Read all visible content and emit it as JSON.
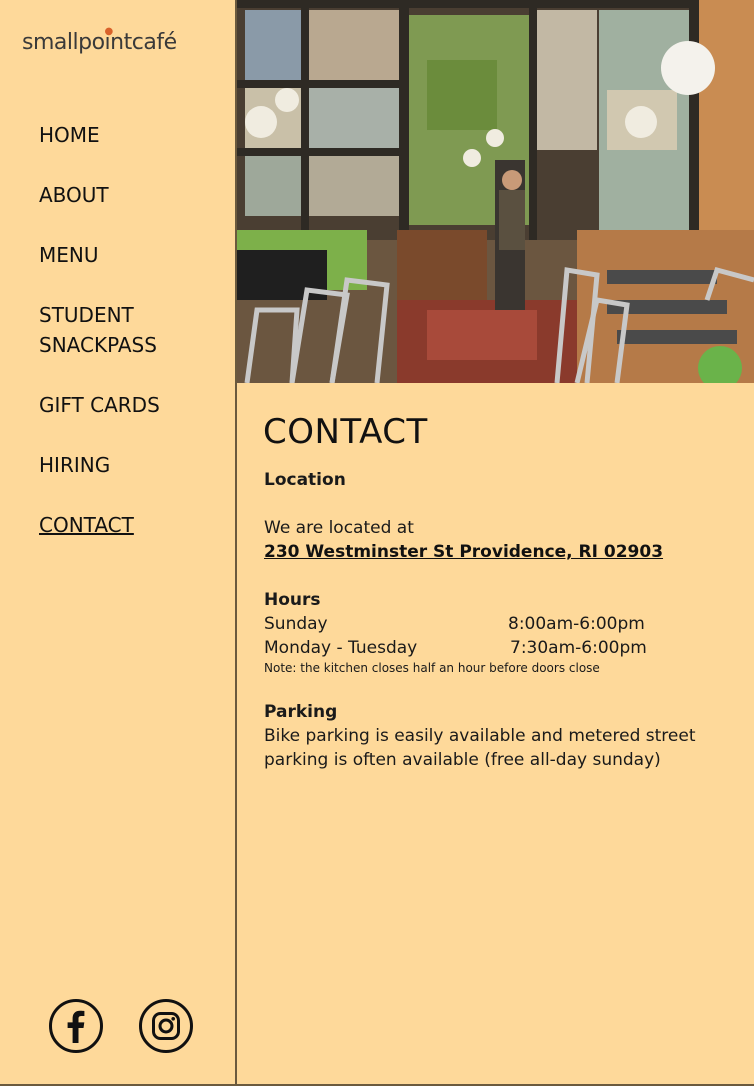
{
  "brand": {
    "name_part1": "small",
    "name_part2": "point",
    "name_part3": "café",
    "accent": "#d9622b"
  },
  "nav": {
    "items": [
      {
        "label": "HOME"
      },
      {
        "label": "ABOUT"
      },
      {
        "label": "MENU"
      },
      {
        "label": "STUDENT SNACKPASS"
      },
      {
        "label": "GIFT CARDS"
      },
      {
        "label": "HIRING"
      },
      {
        "label": "CONTACT",
        "active": true
      }
    ]
  },
  "social": {
    "icons": [
      "facebook-icon",
      "instagram-icon"
    ]
  },
  "page": {
    "title": "CONTACT",
    "location": {
      "heading": "Location",
      "intro": "We are located at",
      "address": "230 Westminster St Providence, RI 02903"
    },
    "hours": {
      "heading": "Hours",
      "rows": [
        {
          "day": "Sunday",
          "time": "8:00am-6:00pm"
        },
        {
          "day": "Monday - Tuesday",
          "time": "7:30am-6:00pm"
        }
      ],
      "note": "Note: the kitchen closes half an hour before doors close"
    },
    "parking": {
      "heading": "Parking",
      "text": "Bike parking is easily available and metered street parking is often available (free all-day sunday)"
    }
  },
  "colors": {
    "background": "#fed99a",
    "border": "#6b5a3e"
  }
}
